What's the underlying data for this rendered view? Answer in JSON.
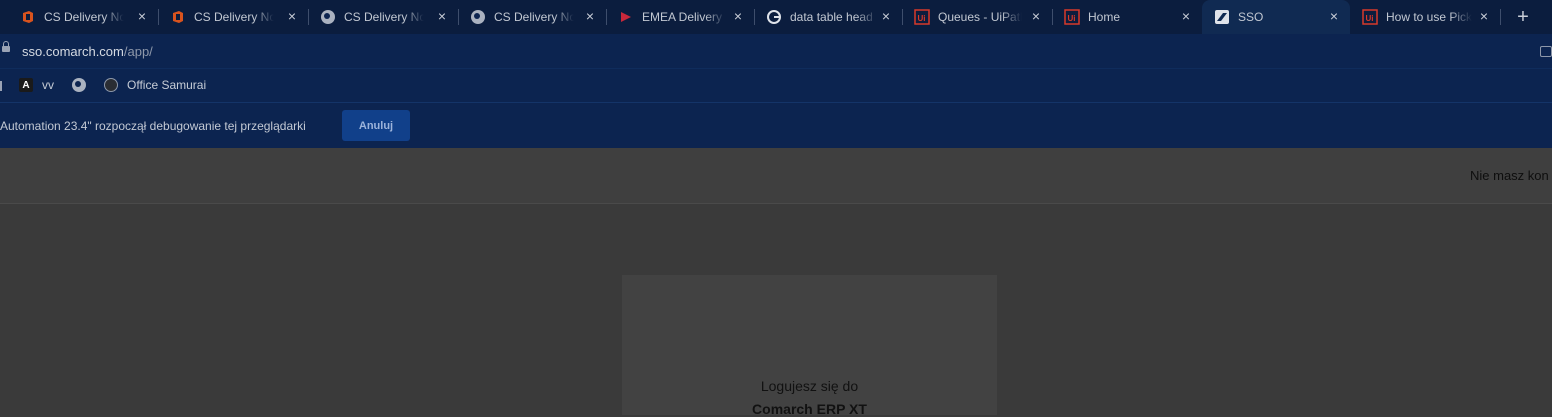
{
  "browser": {
    "tabs": [
      {
        "title": "CS Delivery Not",
        "icon": "office-icon"
      },
      {
        "title": "CS Delivery Not",
        "icon": "office-icon"
      },
      {
        "title": "CS Delivery Not",
        "icon": "globe-icon"
      },
      {
        "title": "CS Delivery Not",
        "icon": "globe-icon"
      },
      {
        "title": "EMEA Delivery",
        "icon": "power-bi-icon"
      },
      {
        "title": "data table head",
        "icon": "google-icon"
      },
      {
        "title": "Queues - UiPath",
        "icon": "uipath-icon"
      },
      {
        "title": "Home",
        "icon": "uipath-icon"
      },
      {
        "title": "SSO",
        "icon": "sso-icon"
      },
      {
        "title": "How to use Pick",
        "icon": "uipath-icon"
      }
    ],
    "new_tab": "+",
    "close_symbol": "×",
    "address": {
      "host": "sso.comarch.com",
      "path": "/app/"
    },
    "bookmarks": [
      {
        "label": "vv",
        "icon": "a-icon"
      },
      {
        "label": "",
        "icon": "globe-icon"
      },
      {
        "label": "Office Samurai",
        "icon": "github-icon"
      }
    ],
    "infobar": {
      "text": "Automation 23.4\" rozpoczął debugowanie tej przeglądarki",
      "cancel_label": "Anuluj"
    }
  },
  "page": {
    "signup_text": "Nie masz kon",
    "card": {
      "line1": "Logujesz się do",
      "line2": "Comarch ERP XT"
    }
  },
  "colors": {
    "tab_strip": "#0b1d3e",
    "toolbar": "#0c2450",
    "cancel_button": "#11408a",
    "page_overlay": "#3a3a3a"
  }
}
